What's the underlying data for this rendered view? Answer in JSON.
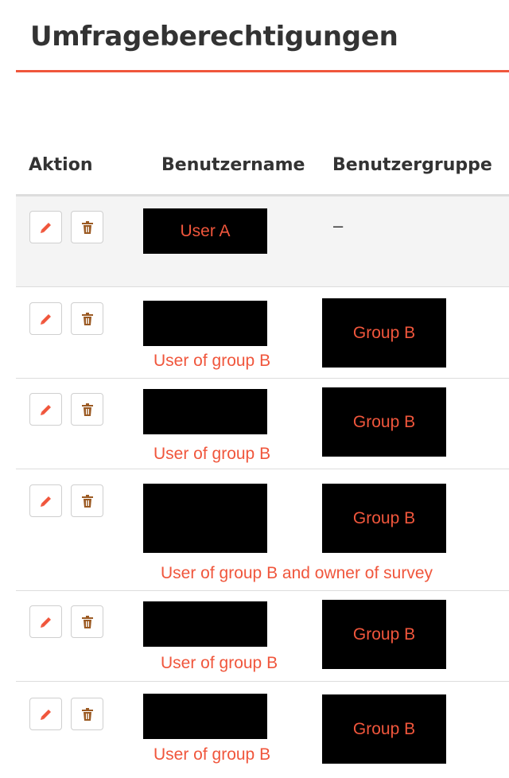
{
  "page": {
    "title": "Umfrageberechtigungen",
    "accent_color": "#f0563c"
  },
  "table": {
    "columns": [
      "Aktion",
      "Benutzername",
      "Benutzergruppe"
    ],
    "actions": {
      "edit_icon": "pencil-icon",
      "delete_icon": "trash-icon"
    },
    "rows": [
      {
        "username": "User A",
        "group": "–",
        "annotation": ""
      },
      {
        "username": "",
        "group": "Group B",
        "annotation": "User of group B"
      },
      {
        "username": "",
        "group": "Group B",
        "annotation": "User of group B"
      },
      {
        "username": "",
        "group": "Group B",
        "annotation": "User of group B and owner of survey"
      },
      {
        "username": "",
        "group": "Group B",
        "annotation": "User of group B"
      },
      {
        "username": "",
        "group": "Group B",
        "annotation": "User of group B"
      }
    ]
  }
}
